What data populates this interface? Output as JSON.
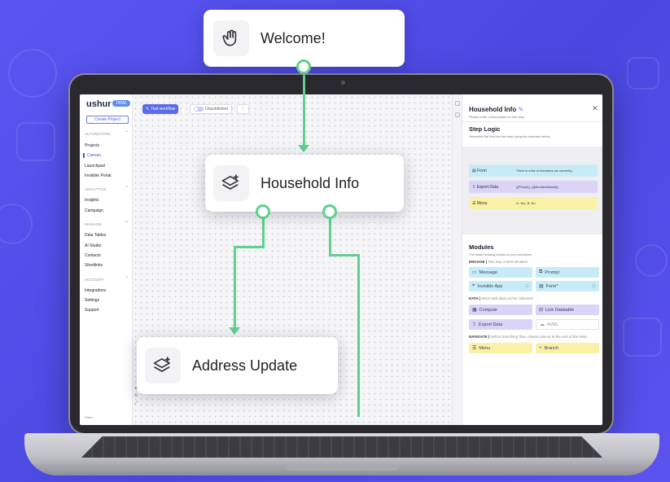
{
  "welcome_card": {
    "label": "Welcome!",
    "icon": "waving-hand-icon"
  },
  "household_card": {
    "label": "Household Info",
    "icon": "layers-plus-icon"
  },
  "address_card": {
    "label": "Address Update",
    "icon": "layers-plus-icon"
  },
  "sidebar": {
    "logo": "ushur",
    "trial_badge": "TRIAL",
    "create_button": "Create Project",
    "sections": [
      {
        "title": "AUTOMATION",
        "items": [
          "Projects",
          "Canvas",
          "Launchpad",
          "Invisible Portal"
        ]
      },
      {
        "title": "ANALYTICS",
        "items": [
          "Insights",
          "Campaign"
        ]
      },
      {
        "title": "MANAGE",
        "items": [
          "Data Tables",
          "AI Studio",
          "Contacts",
          "Shortlinks"
        ]
      },
      {
        "title": "ACCOUNT",
        "items": [
          "Integrations",
          "Settings",
          "Support"
        ]
      }
    ],
    "footer": "Ethan"
  },
  "toolbar": {
    "test_label": "Test workflow",
    "publish_label": "Unpublished",
    "more_label": "⋮"
  },
  "panel": {
    "title": "Household Info",
    "description_placeholder": "Please enter a description for this step",
    "step_logic_title": "Step Logic",
    "step_logic_sub": "Assemble the flow for this step using the modules below.",
    "logic": [
      {
        "label": "Form",
        "value": "\"Here is a list of members we currently...",
        "color": "#c7ecf7"
      },
      {
        "label": "Export Data",
        "value": "{{Phone}}, {{MembersName}}",
        "color": "#d9d4f8"
      },
      {
        "label": "Menu",
        "value": "A: Yes, B: No",
        "color": "#fbf1a6"
      }
    ],
    "modules_title": "Modules",
    "modules_sub": "The basic building blocks of your workflows.",
    "engage_label": "ENGAGE",
    "engage_desc": "Two way communication.",
    "engage": [
      "Message",
      "Prompt",
      "Invisible App",
      "Form*"
    ],
    "data_label": "DATA",
    "data_desc": "Work with data you've collected",
    "data": [
      "Compute",
      "Link Datatable",
      "Export Data",
      "AI/ML"
    ],
    "navigate_label": "NAVIGATE",
    "navigate_desc": "Define branching flow. Always placed at the end of the Step",
    "navigate": [
      "Menu",
      "Branch"
    ]
  },
  "colors": {
    "accent": "#5b6bea",
    "connector": "#5fd08f",
    "background": "#4a47e0"
  }
}
